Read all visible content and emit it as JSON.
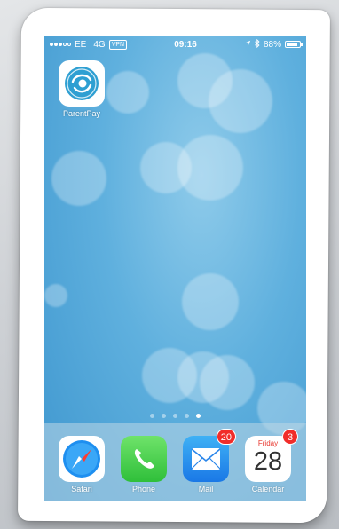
{
  "status_bar": {
    "carrier": "EE",
    "network": "4G",
    "vpn": "VPN",
    "time": "09:16",
    "battery": "88%",
    "battery_level": 0.88
  },
  "apps": [
    {
      "label": "ParentPay",
      "icon": "parentpay-icon"
    }
  ],
  "page_indicator": {
    "pages": 5,
    "active_index": 4
  },
  "dock": [
    {
      "label": "Safari",
      "icon": "safari-icon",
      "badge": ""
    },
    {
      "label": "Phone",
      "icon": "phone-icon",
      "badge": ""
    },
    {
      "label": "Mail",
      "icon": "mail-icon",
      "badge": "20"
    },
    {
      "label": "Calendar",
      "icon": "calendar-icon",
      "badge": "3",
      "day": "Friday",
      "date": "28"
    }
  ],
  "colors": {
    "wallpaper": "#5fb0de",
    "badge": "#f12d2a",
    "phone_green": "#2fbf3a",
    "mail_blue": "#1a78e6",
    "calendar_red": "#e8382f"
  }
}
